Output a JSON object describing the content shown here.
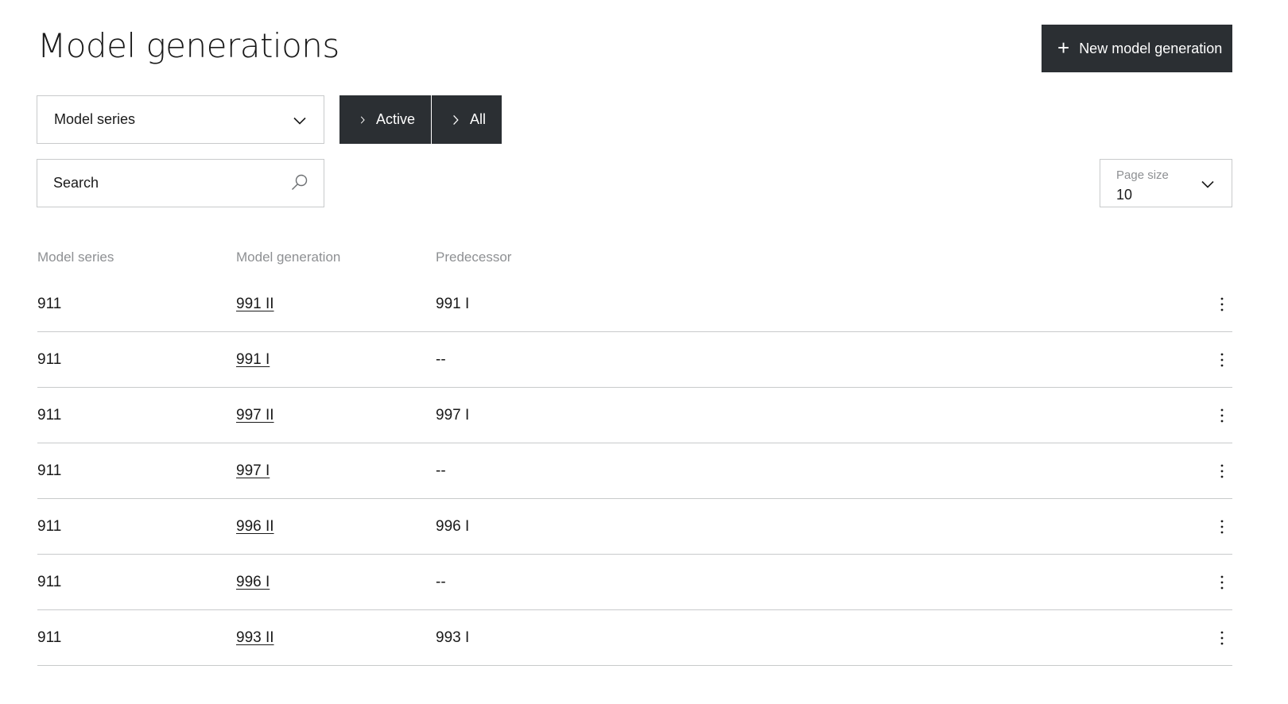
{
  "header": {
    "title": "Model generations",
    "new_button_label": "New model generation"
  },
  "filters": {
    "series_select_value": "Model series",
    "toggle_active_label": "Active",
    "toggle_all_label": "All",
    "search_placeholder": "Search",
    "page_size_label": "Page size",
    "page_size_value": "10"
  },
  "table": {
    "columns": [
      "Model series",
      "Model generation",
      "Predecessor"
    ],
    "rows": [
      {
        "series": "911",
        "generation": "991 II",
        "predecessor": "991 I"
      },
      {
        "series": "911",
        "generation": "991 I",
        "predecessor": "--"
      },
      {
        "series": "911",
        "generation": "997 II",
        "predecessor": "997 I"
      },
      {
        "series": "911",
        "generation": "997 I",
        "predecessor": "--"
      },
      {
        "series": "911",
        "generation": "996 II",
        "predecessor": "996 I"
      },
      {
        "series": "911",
        "generation": "996 I",
        "predecessor": "--"
      },
      {
        "series": "911",
        "generation": "993 II",
        "predecessor": "993 I"
      }
    ]
  },
  "colors": {
    "dark_button": "#2b2f33",
    "border": "#c8cacb",
    "muted_text": "#8e9093",
    "text": "#1a1a1a"
  },
  "icons": {
    "plus": "plus-icon",
    "chevron": "chevron-down-icon",
    "arrow": "chevron-right-icon",
    "search": "search-icon",
    "menu": "more-vertical-icon"
  }
}
